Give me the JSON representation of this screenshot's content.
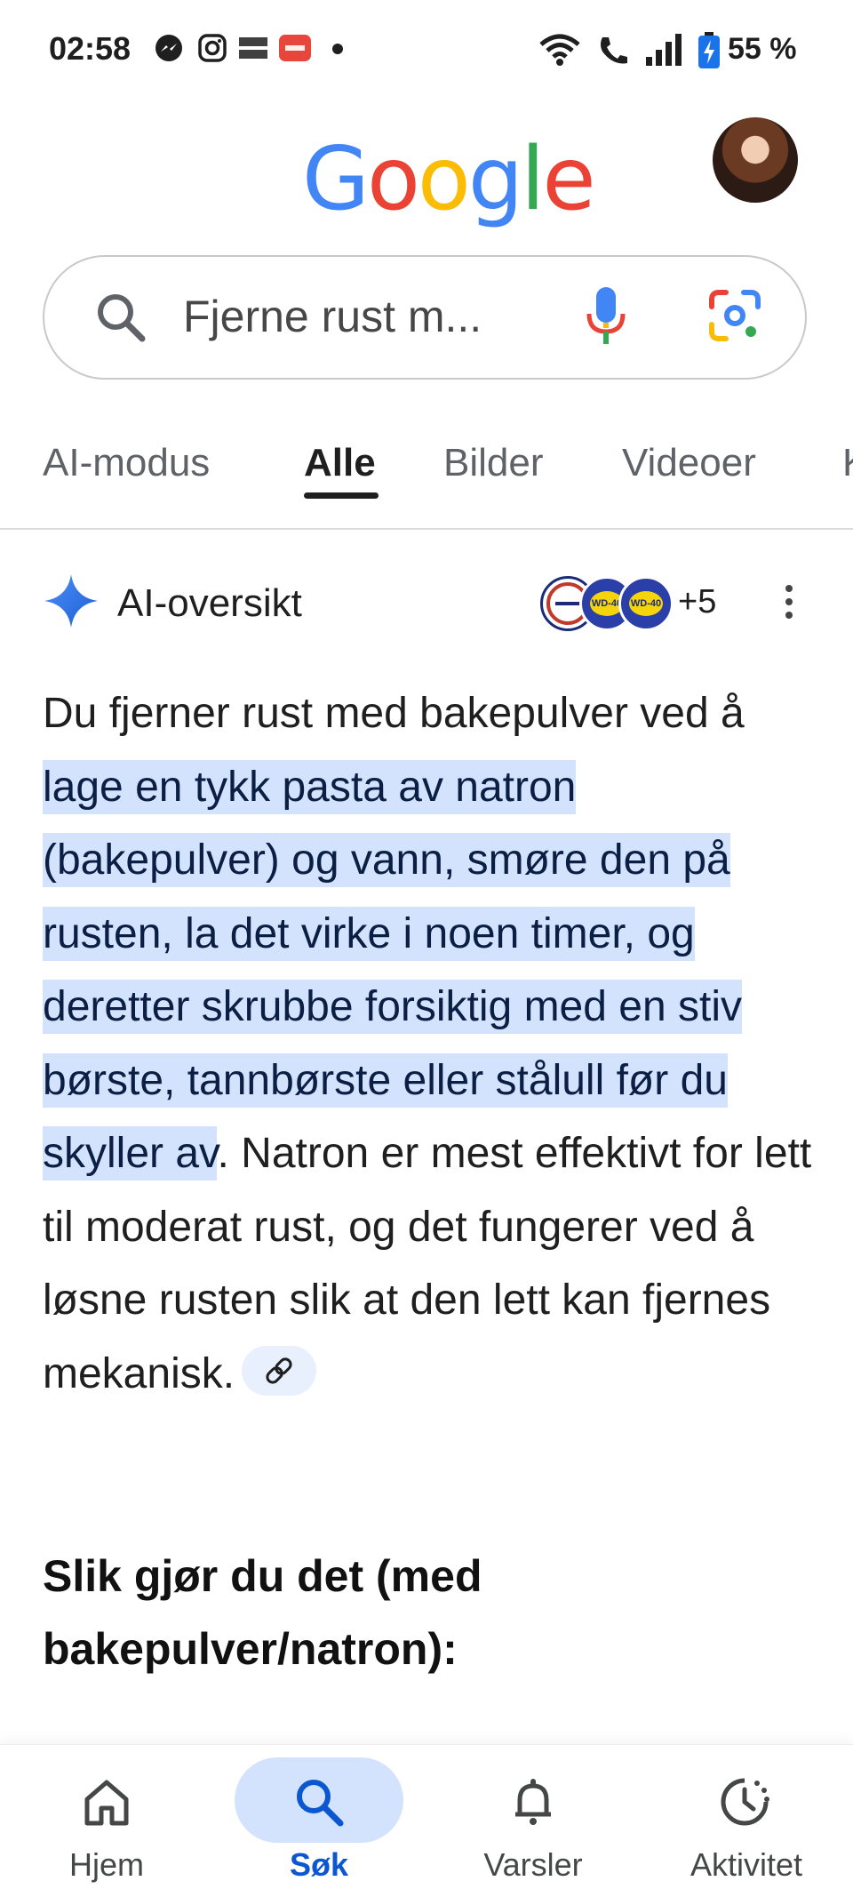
{
  "status_bar": {
    "time": "02:58",
    "battery_percent": "55 %",
    "notification_icons": [
      "messenger-icon",
      "instagram-icon",
      "temu-icon",
      "sos-icon",
      "dot-icon"
    ],
    "system_icons": [
      "wifi-icon",
      "wifi-call-icon",
      "signal-icon",
      "battery-charging-icon"
    ]
  },
  "header": {
    "logo": [
      "G",
      "o",
      "o",
      "g",
      "l",
      "e"
    ],
    "logo_colors": [
      "#4285F4",
      "#EA4335",
      "#FBBC05",
      "#4285F4",
      "#34A853",
      "#EA4335"
    ]
  },
  "search": {
    "query": "Fjerne rust m..."
  },
  "tabs": [
    {
      "label": "AI-modus"
    },
    {
      "label": "Alle",
      "active": true
    },
    {
      "label": "Bilder"
    },
    {
      "label": "Videoer"
    },
    {
      "label": "K"
    }
  ],
  "ai_overview": {
    "title": "AI-oversikt",
    "sources_more": "+5",
    "source_logo_text": "WD-40",
    "paragraph": {
      "intro": "Du fjerner rust med bakepulver ved å ",
      "highlight": "lage en tykk pasta av natron (bakepulver) og vann, smøre den på rusten, la det virke i noen timer, og deretter skrubbe forsiktig med en stiv børste, tannbørste eller stålull før du skyller av",
      "rest": ". Natron er mest effektivt for lett til moderat rust, og det fungerer ved å løsne rusten slik at den lett kan fjernes mekanisk."
    },
    "subheading": "Slik gjør du det (med bakepulver/natron):"
  },
  "bottom_nav": [
    {
      "label": "Hjem",
      "icon": "home-icon"
    },
    {
      "label": "Søk",
      "icon": "search-icon",
      "active": true
    },
    {
      "label": "Varsler",
      "icon": "bell-icon"
    },
    {
      "label": "Aktivitet",
      "icon": "activity-icon"
    }
  ],
  "colors": {
    "accent": "#0b57d0",
    "highlight": "#d3e3fd"
  }
}
